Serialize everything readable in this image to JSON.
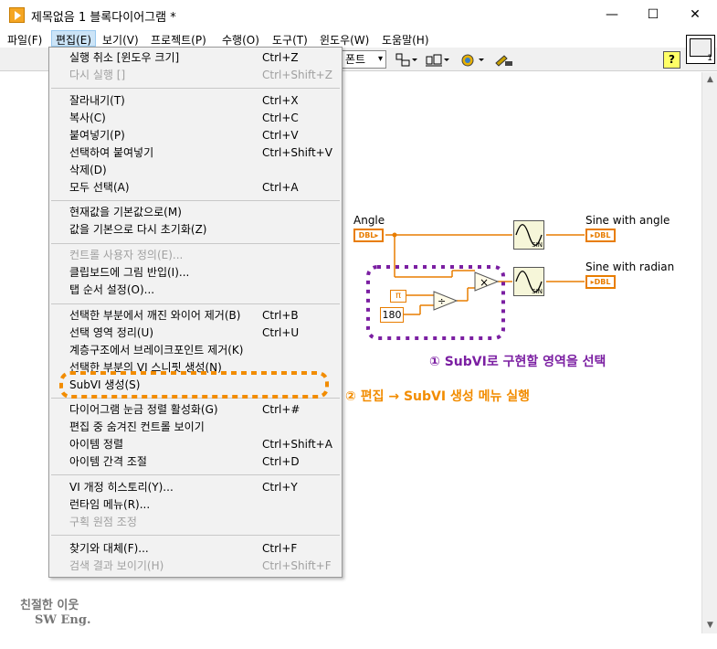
{
  "window": {
    "title": "제목없음 1 블록다이어그램 *",
    "minimize": "—",
    "maximize": "☐",
    "close": "✕"
  },
  "menubar": {
    "items": [
      {
        "label": "파일(F)"
      },
      {
        "label": "편집(E)",
        "active": true
      },
      {
        "label": "보기(V)"
      },
      {
        "label": "프로젝트(P)"
      },
      {
        "label": "수행(O)"
      },
      {
        "label": "도구(T)"
      },
      {
        "label": "윈도우(W)"
      },
      {
        "label": "도움말(H)"
      }
    ]
  },
  "toolbar": {
    "font_label": "폰트",
    "help_label": "?"
  },
  "vi_icon": {
    "number": "1"
  },
  "edit_menu": {
    "items": [
      {
        "label": "실행 취소 [윈도우 크기]",
        "shortcut": "Ctrl+Z",
        "disabled": false
      },
      {
        "label": "다시 실행 []",
        "shortcut": "Ctrl+Shift+Z",
        "disabled": true
      },
      {
        "label": "잘라내기(T)",
        "shortcut": "Ctrl+X",
        "disabled": false
      },
      {
        "label": "복사(C)",
        "shortcut": "Ctrl+C",
        "disabled": false
      },
      {
        "label": "붙여넣기(P)",
        "shortcut": "Ctrl+V",
        "disabled": false
      },
      {
        "label": "선택하여 붙여넣기",
        "shortcut": "Ctrl+Shift+V",
        "disabled": false
      },
      {
        "label": "삭제(D)",
        "shortcut": "",
        "disabled": false
      },
      {
        "label": "모두 선택(A)",
        "shortcut": "Ctrl+A",
        "disabled": false
      },
      {
        "label": "현재값을 기본값으로(M)",
        "shortcut": "",
        "disabled": false
      },
      {
        "label": "값을 기본으로 다시 초기화(Z)",
        "shortcut": "",
        "disabled": false
      },
      {
        "label": "컨트롤 사용자 정의(E)...",
        "shortcut": "",
        "disabled": true
      },
      {
        "label": "클립보드에 그림 반입(I)...",
        "shortcut": "",
        "disabled": false
      },
      {
        "label": "탭 순서 설정(O)...",
        "shortcut": "",
        "disabled": false
      },
      {
        "label": "선택한 부분에서 깨진 와이어 제거(B)",
        "shortcut": "Ctrl+B",
        "disabled": false
      },
      {
        "label": "선택 영역 정리(U)",
        "shortcut": "Ctrl+U",
        "disabled": false
      },
      {
        "label": "계층구조에서 브레이크포인트 제거(K)",
        "shortcut": "",
        "disabled": false
      },
      {
        "label": "선택한 부분의 VI 스니핏 생성(N)",
        "shortcut": "",
        "disabled": false
      },
      {
        "label": "SubVI 생성(S)",
        "shortcut": "",
        "disabled": false
      },
      {
        "label": "다이어그램 눈금 정렬 활성화(G)",
        "shortcut": "Ctrl+#",
        "disabled": false
      },
      {
        "label": "편집 중 숨겨진 컨트롤 보이기",
        "shortcut": "",
        "disabled": false
      },
      {
        "label": "아이템 정렬",
        "shortcut": "Ctrl+Shift+A",
        "disabled": false
      },
      {
        "label": "아이템 간격 조절",
        "shortcut": "Ctrl+D",
        "disabled": false
      },
      {
        "label": "VI 개정 히스토리(Y)...",
        "shortcut": "Ctrl+Y",
        "disabled": false
      },
      {
        "label": "런타임 메뉴(R)...",
        "shortcut": "",
        "disabled": false
      },
      {
        "label": "구획 원점 조정",
        "shortcut": "",
        "disabled": true
      },
      {
        "label": "찾기와 대체(F)...",
        "shortcut": "Ctrl+F",
        "disabled": false
      },
      {
        "label": "검색 결과 보이기(H)",
        "shortcut": "Ctrl+Shift+F",
        "disabled": true
      }
    ]
  },
  "diagram": {
    "angle_label": "Angle",
    "dbl_label": "DBL",
    "sine_angle_label": "Sine with angle",
    "sine_radian_label": "Sine with radian",
    "sin_text": "SIN",
    "pi_label": "π",
    "const_180": "180",
    "multiply_symbol": "×",
    "divide_symbol": "÷"
  },
  "annotations": {
    "step1": "① SubVI로 구현할 영역을 선택",
    "step2": "② 편집 → SubVI 생성 메뉴 실행",
    "step1_color": "#7b1fa2",
    "step2_color": "#f28c00"
  },
  "watermark": {
    "line1": "친절한 이웃",
    "line2": "SW Eng."
  }
}
